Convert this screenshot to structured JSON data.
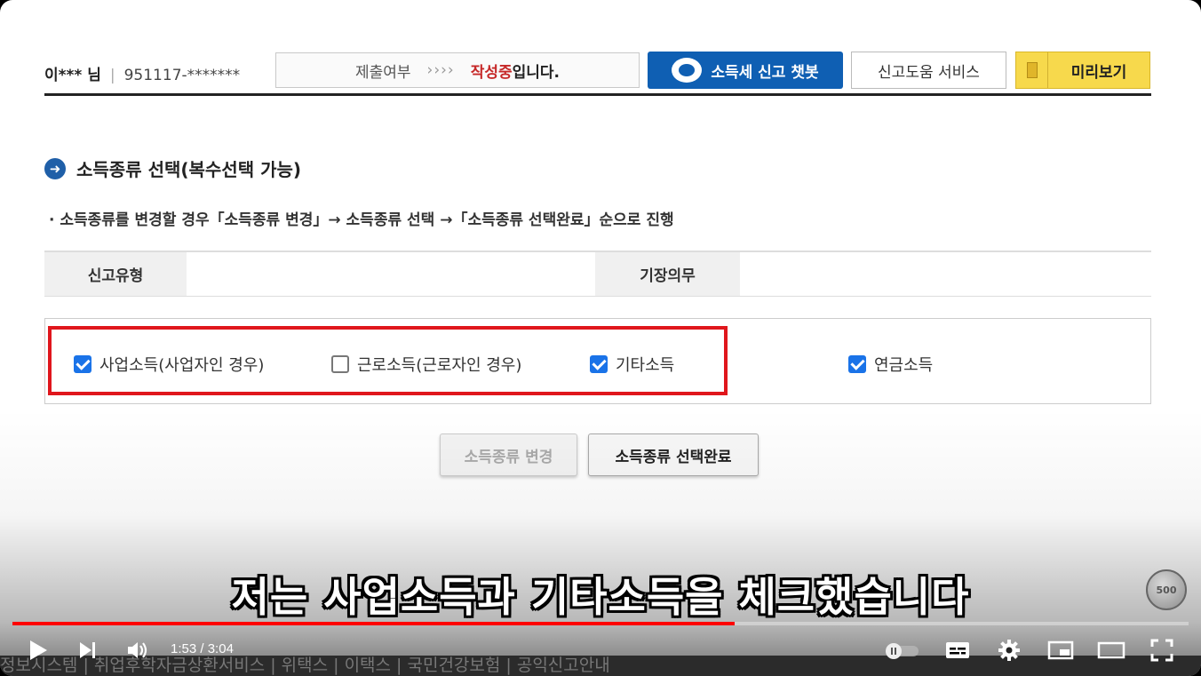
{
  "header": {
    "user_name": "이*** 님",
    "user_id": "951117-*******",
    "status_label": "제출여부",
    "status_arrows": "››››",
    "status_value": "작성중",
    "status_suffix": "입니다.",
    "chatbot_label": "소득세 신고 챗봇",
    "help_label": "신고도움 서비스",
    "preview_label": "미리보기"
  },
  "section": {
    "title": "소득종류 선택(복수선택 가능)",
    "note": "· 소득종류를 변경할 경우「소득종류 변경」→ 소득종류 선택 →「소득종류 선택완료」순으로 진행"
  },
  "info_table": {
    "col1_header": "신고유형",
    "col1_value": "",
    "col2_header": "기장의무",
    "col2_value": ""
  },
  "income_types": [
    {
      "label": "사업소득(사업자인 경우)",
      "checked": true
    },
    {
      "label": "근로소득(근로자인 경우)",
      "checked": false
    },
    {
      "label": "기타소득",
      "checked": true
    },
    {
      "label": "연금소득",
      "checked": true
    }
  ],
  "buttons": {
    "change": "소득종류 변경",
    "complete": "소득종류 선택완료"
  },
  "video": {
    "subtitle": "저는 사업소득과 기타소득을 체크했습니다",
    "coin_label": "500",
    "current_time": "1:53",
    "duration": "3:04",
    "time_sep": " / ",
    "progress": 0.614,
    "accent_color": "#ff0000"
  },
  "bottom_strip": "정보시스템  |  취업후학자금상환서비스  |  위택스  |  이택스  |  국민건강보험  |  공익신고안내"
}
